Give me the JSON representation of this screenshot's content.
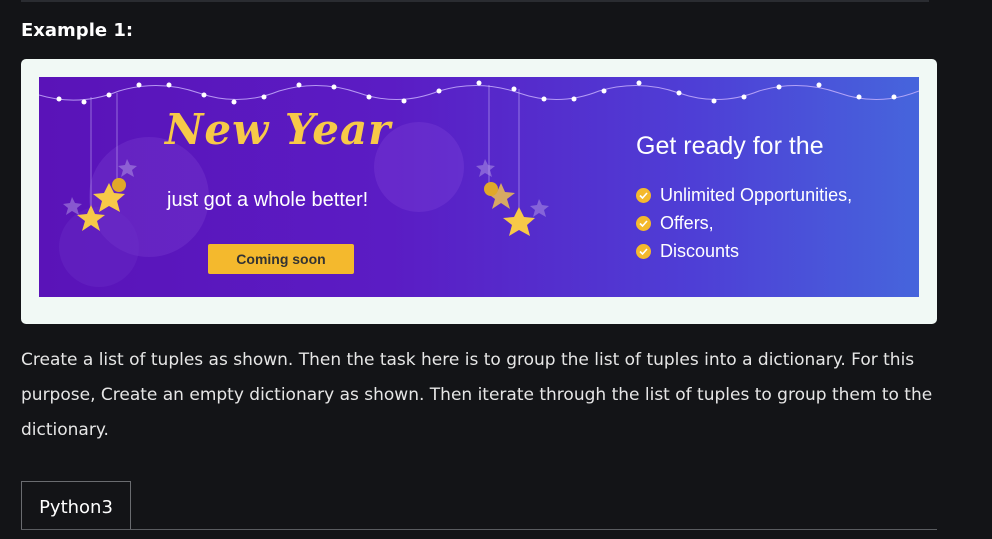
{
  "heading": "Example 1:",
  "banner": {
    "title": "New Year",
    "subtitle": "just got a whole better!",
    "button_label": "Coming soon",
    "ready_title": "Get ready for the",
    "perks": [
      "Unlimited Opportunities,",
      "Offers,",
      "Discounts"
    ],
    "colors": {
      "accent": "#f4b92d",
      "gradient_start": "#5a13b8",
      "gradient_end": "#4665dc"
    }
  },
  "paragraph": "Create a list of tuples as shown. Then the task here is to group the list of tuples into a dictionary. For this purpose, Create an empty dictionary as shown. Then iterate through the list of tuples to group them to the dictionary.",
  "code_tabs": {
    "active_tab": "Python3"
  }
}
